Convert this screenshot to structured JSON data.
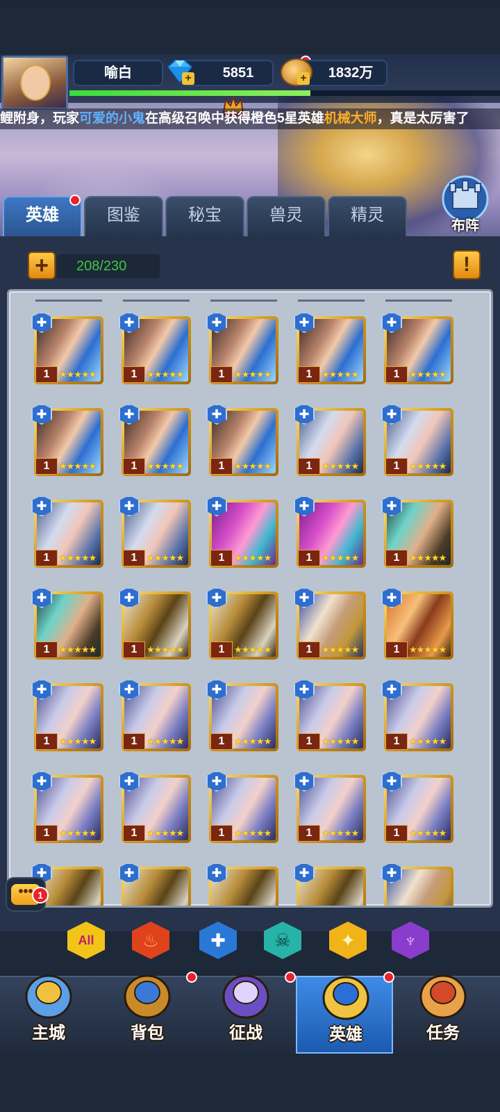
{
  "header": {
    "player_name": "喻白",
    "gems": "5851",
    "gold": "1832万",
    "exp_fraction": 0.56,
    "ticker_parts": [
      {
        "text": "鲤附身，玩家",
        "style": "plain"
      },
      {
        "text": "可爱的小鬼",
        "style": "blue"
      },
      {
        "text": "在高级召唤中获得橙色5星英雄",
        "style": "plain"
      },
      {
        "text": "机械大师",
        "style": "orange"
      },
      {
        "text": "，真是太厉害了",
        "style": "plain"
      }
    ]
  },
  "tabs": [
    {
      "label": "英雄",
      "active": true,
      "badge": true
    },
    {
      "label": "图鉴",
      "active": false,
      "badge": false
    },
    {
      "label": "秘宝",
      "active": false,
      "badge": false
    },
    {
      "label": "兽灵",
      "active": false,
      "badge": false
    },
    {
      "label": "精灵",
      "active": false,
      "badge": false
    }
  ],
  "formation_label": "布阵",
  "hero_count": "208/230",
  "heroes": [
    {
      "portrait": "warrior",
      "level": "1",
      "stars": 5
    },
    {
      "portrait": "warrior",
      "level": "1",
      "stars": 5
    },
    {
      "portrait": "warrior",
      "level": "1",
      "stars": 5
    },
    {
      "portrait": "warrior",
      "level": "1",
      "stars": 5
    },
    {
      "portrait": "warrior",
      "level": "1",
      "stars": 5
    },
    {
      "portrait": "warrior",
      "level": "1",
      "stars": 5
    },
    {
      "portrait": "warrior",
      "level": "1",
      "stars": 5
    },
    {
      "portrait": "warrior",
      "level": "1",
      "stars": 5
    },
    {
      "portrait": "mage",
      "level": "1",
      "stars": 5
    },
    {
      "portrait": "mage",
      "level": "1",
      "stars": 5
    },
    {
      "portrait": "mage",
      "level": "1",
      "stars": 5
    },
    {
      "portrait": "mage",
      "level": "1",
      "stars": 5
    },
    {
      "portrait": "witch",
      "level": "1",
      "stars": 5
    },
    {
      "portrait": "witch",
      "level": "1",
      "stars": 5
    },
    {
      "portrait": "engineer",
      "level": "1",
      "stars": 5
    },
    {
      "portrait": "engineer",
      "level": "1",
      "stars": 5
    },
    {
      "portrait": "knight",
      "level": "1",
      "stars": 5
    },
    {
      "portrait": "knight",
      "level": "1",
      "stars": 5
    },
    {
      "portrait": "elder",
      "level": "1",
      "stars": 5
    },
    {
      "portrait": "pirate",
      "level": "1",
      "stars": 5
    },
    {
      "portrait": "sorceress",
      "level": "1",
      "stars": 5
    },
    {
      "portrait": "sorceress",
      "level": "1",
      "stars": 5
    },
    {
      "portrait": "sorceress",
      "level": "1",
      "stars": 5
    },
    {
      "portrait": "sorceress",
      "level": "1",
      "stars": 5
    },
    {
      "portrait": "sorceress",
      "level": "1",
      "stars": 5
    },
    {
      "portrait": "sorceress",
      "level": "1",
      "stars": 5
    },
    {
      "portrait": "sorceress",
      "level": "1",
      "stars": 5
    },
    {
      "portrait": "sorceress",
      "level": "1",
      "stars": 5
    },
    {
      "portrait": "sorceress",
      "level": "1",
      "stars": 5
    },
    {
      "portrait": "sorceress",
      "level": "1",
      "stars": 5
    }
  ],
  "chat_unread": "1",
  "filters": [
    {
      "label": "All",
      "color": "#f2c418",
      "text_color": "#c21c6a",
      "icon": "all-icon"
    },
    {
      "label": "",
      "color": "#e0421c",
      "text_color": "#ffb347",
      "icon": "fire-icon"
    },
    {
      "label": "",
      "color": "#2a78d6",
      "text_color": "#ffffff",
      "icon": "cross-icon"
    },
    {
      "label": "",
      "color": "#27b3a8",
      "text_color": "#0f3d3a",
      "icon": "skull-icon"
    },
    {
      "label": "",
      "color": "#f0b418",
      "text_color": "#fff4c0",
      "icon": "wing-icon"
    },
    {
      "label": "",
      "color": "#8a3ccc",
      "text_color": "#e6c2ff",
      "icon": "demon-icon"
    }
  ],
  "nav": [
    {
      "label": "主城",
      "icon": "castle-icon",
      "active": false,
      "badge": false
    },
    {
      "label": "背包",
      "icon": "chest-icon",
      "active": false,
      "badge": true
    },
    {
      "label": "征战",
      "icon": "portal-icon",
      "active": false,
      "badge": true
    },
    {
      "label": "英雄",
      "icon": "helmet-icon",
      "active": true,
      "badge": true
    },
    {
      "label": "任务",
      "icon": "scroll-icon",
      "active": false,
      "badge": false
    }
  ]
}
